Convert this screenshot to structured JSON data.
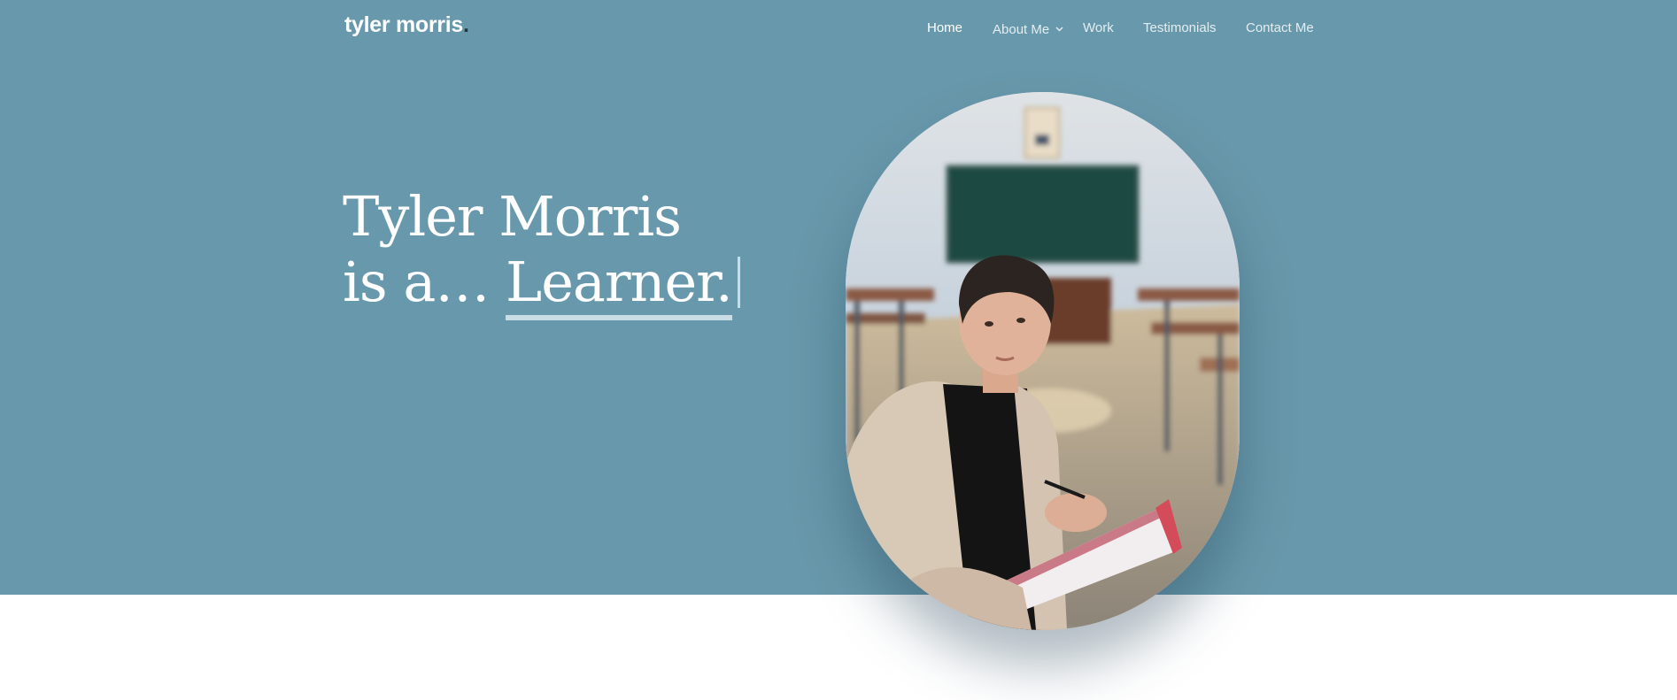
{
  "brand": {
    "name": "tyler morris",
    "dot": "."
  },
  "nav": {
    "items": [
      {
        "label": "Home",
        "active": true
      },
      {
        "label": "About Me",
        "has_dropdown": true
      },
      {
        "label": "Work"
      },
      {
        "label": "Testimonials"
      },
      {
        "label": "Contact Me"
      }
    ]
  },
  "hero": {
    "line1": "Tyler Morris",
    "line2_prefix": "is a…",
    "typed_word": "Learner.",
    "portrait_alt": "Tyler Morris standing in a classroom holding a notebook and pen"
  },
  "colors": {
    "hero_bg": "#6898ab",
    "accent_underline": "#c9dde6",
    "logo_dot": "#26353d"
  },
  "icons": {
    "dropdown": "chevron-down-icon"
  }
}
